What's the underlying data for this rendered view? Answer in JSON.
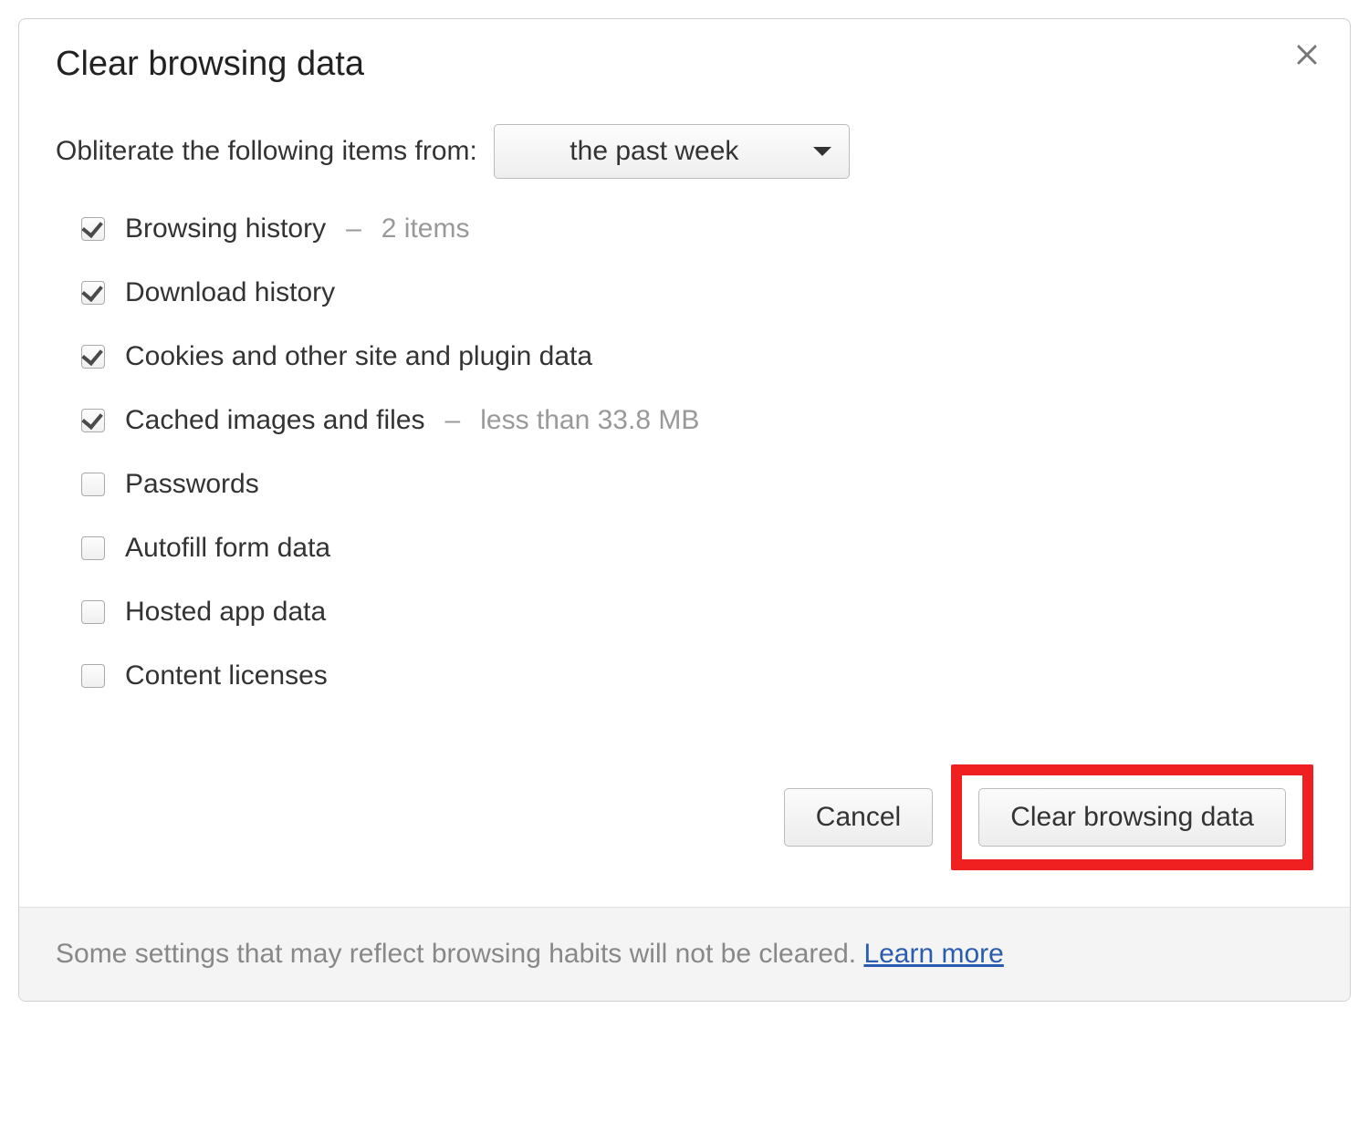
{
  "dialog": {
    "title": "Clear browsing data",
    "time_range": {
      "label": "Obliterate the following items from:",
      "selected": "the past week"
    },
    "options": [
      {
        "label": "Browsing history",
        "checked": true,
        "note": "2 items"
      },
      {
        "label": "Download history",
        "checked": true,
        "note": null
      },
      {
        "label": "Cookies and other site and plugin data",
        "checked": true,
        "note": null
      },
      {
        "label": "Cached images and files",
        "checked": true,
        "note": "less than 33.8 MB"
      },
      {
        "label": "Passwords",
        "checked": false,
        "note": null
      },
      {
        "label": "Autofill form data",
        "checked": false,
        "note": null
      },
      {
        "label": "Hosted app data",
        "checked": false,
        "note": null
      },
      {
        "label": "Content licenses",
        "checked": false,
        "note": null
      }
    ],
    "actions": {
      "cancel": "Cancel",
      "clear": "Clear browsing data"
    },
    "footer": {
      "text": "Some settings that may reflect browsing habits will not be cleared. ",
      "learn_more": "Learn more"
    }
  }
}
